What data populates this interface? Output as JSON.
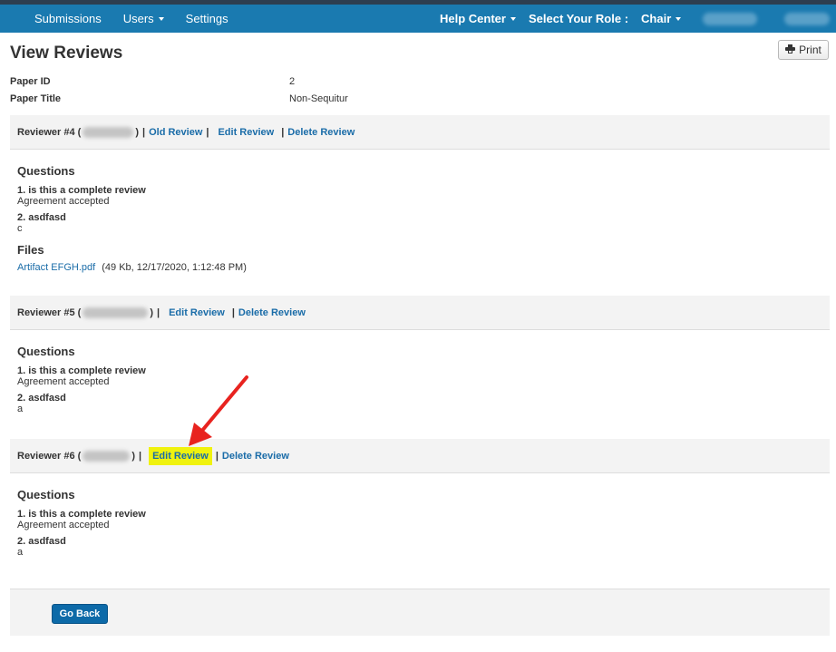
{
  "nav": {
    "submissions": "Submissions",
    "users": "Users",
    "settings": "Settings",
    "help_center": "Help Center",
    "select_role": "Select Your Role :",
    "role": "Chair"
  },
  "page": {
    "title": "View Reviews",
    "print_label": "Print"
  },
  "paper": {
    "id_label": "Paper ID",
    "id_value": "2",
    "title_label": "Paper Title",
    "title_value": "Non-Sequitur"
  },
  "reviews": [
    {
      "label": "Reviewer #4 (",
      "close": ")",
      "old_review": "Old Review",
      "edit_review": "Edit Review",
      "delete_review": "Delete Review",
      "questions_heading": "Questions",
      "questions": [
        {
          "q": "1. is this a complete review",
          "a": "Agreement accepted"
        },
        {
          "q": "2. asdfasd",
          "a": "c"
        }
      ],
      "files_heading": "Files",
      "file_name": "Artifact EFGH.pdf",
      "file_meta": "(49 Kb, 12/17/2020, 1:12:48 PM)"
    },
    {
      "label": "Reviewer #5 (",
      "close": ")",
      "edit_review": "Edit Review",
      "delete_review": "Delete Review",
      "questions_heading": "Questions",
      "questions": [
        {
          "q": "1. is this a complete review",
          "a": "Agreement accepted"
        },
        {
          "q": "2. asdfasd",
          "a": "a"
        }
      ]
    },
    {
      "label": "Reviewer #6 (",
      "close": ")",
      "edit_review": "Edit Review",
      "delete_review": "Delete Review",
      "questions_heading": "Questions",
      "questions": [
        {
          "q": "1. is this a complete review",
          "a": "Agreement accepted"
        },
        {
          "q": "2. asdfasd",
          "a": "a"
        }
      ]
    }
  ],
  "separator": "|",
  "footer": {
    "go_back": "Go Back"
  },
  "icons": {
    "caret": "chevron-down-icon",
    "print": "printer-icon",
    "annotation": "red-arrow-icon"
  },
  "colors": {
    "navbar": "#1a7ab0",
    "link": "#1a6ca8",
    "highlight": "#f0f20e",
    "arrow": "#e8231f",
    "button": "#0d6aa8"
  }
}
